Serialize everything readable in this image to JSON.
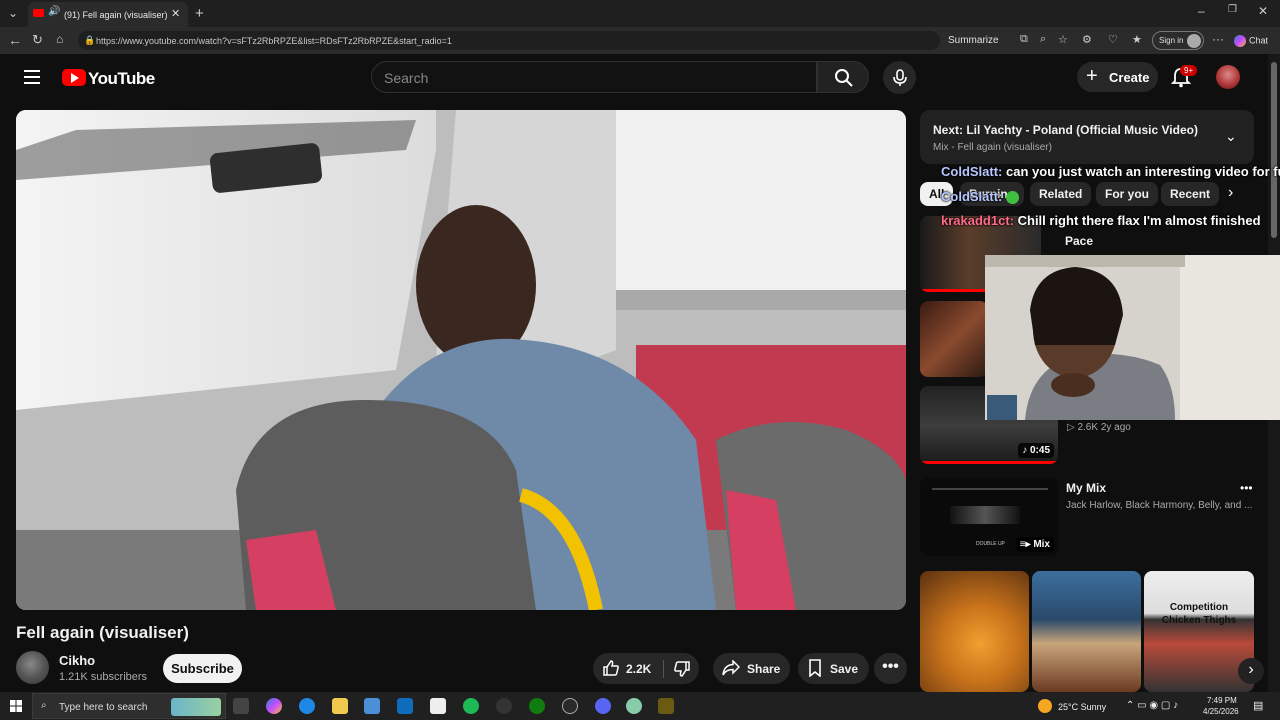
{
  "browser": {
    "tab_title": "(91) Fell again (visualiser) - Yo",
    "url": "https://www.youtube.com/watch?v=sFTz2RbRPZE&list=RDsFTz2RbRPZE&start_radio=1",
    "summarize": "Summarize",
    "sign_in": "Sign in",
    "chat": "Chat"
  },
  "youtube": {
    "logo": "YouTube",
    "search_placeholder": "Search",
    "create": "Create",
    "notifications_badge": "9+"
  },
  "video": {
    "title": "Fell again (visualiser)",
    "channel": "Cikho",
    "subscribers": "1.21K subscribers",
    "subscribe": "Subscribe",
    "likes": "2.2K",
    "share": "Share",
    "save": "Save"
  },
  "sidebar": {
    "next_label": "Next: Lil Yachty - Poland (Official Music Video)",
    "mix_label": "Mix - Fell again (visualiser)",
    "chips": [
      "All",
      "Burning",
      "Related",
      "For you",
      "Recent"
    ],
    "item1_title_fragment": "Pace",
    "item3_meta": "2.6K   2y ago",
    "item3_duration": "0:45",
    "mix_title": "My Mix",
    "mix_sub": "Jack Harlow, Black Harmony, Belly, and ...",
    "mix_badge": "Mix",
    "mix_thumb_text": "DOUBLE UP",
    "short3_caption": "Competition Chicken Thighs"
  },
  "chat_overlay": [
    {
      "user": "ColdSlatt:",
      "message": "can you just watch an interesting video for fu"
    },
    {
      "user": "ColdSlatt:",
      "message": ""
    },
    {
      "user": "krakadd1ct:",
      "message": "Chill right there flax I'm almost finished"
    }
  ],
  "taskbar": {
    "search_placeholder": "Type here to search",
    "weather": "25°C  Sunny",
    "time": "7:49 PM",
    "date": "4/25/2026"
  }
}
